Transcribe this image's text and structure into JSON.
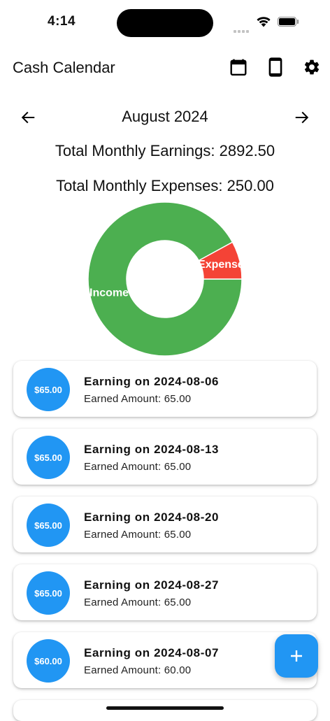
{
  "status_bar": {
    "time": "4:14"
  },
  "app_bar": {
    "title": "Cash Calendar",
    "actions": [
      {
        "icon": "calendar-icon"
      },
      {
        "icon": "phone-icon"
      },
      {
        "icon": "gear-icon"
      }
    ]
  },
  "month_nav": {
    "prev_icon": "arrow-left-icon",
    "next_icon": "arrow-right-icon",
    "month": "August 2024"
  },
  "summary": {
    "earnings": "Total Monthly Earnings: 2892.50",
    "expenses": "Total Monthly Expenses: 250.00"
  },
  "chart_data": {
    "type": "pie",
    "donut": true,
    "categories": [
      "Income",
      "Expense"
    ],
    "values": [
      2892.5,
      250.0
    ],
    "colors": [
      "#4CAF50",
      "#F44336"
    ],
    "labels": [
      "Income",
      "Expense"
    ]
  },
  "entries": [
    {
      "badge": "$65.00",
      "title": "Earning on 2024-08-06",
      "subtitle": "Earned Amount: 65.00"
    },
    {
      "badge": "$65.00",
      "title": "Earning on 2024-08-13",
      "subtitle": "Earned Amount: 65.00"
    },
    {
      "badge": "$65.00",
      "title": "Earning on 2024-08-20",
      "subtitle": "Earned Amount: 65.00"
    },
    {
      "badge": "$65.00",
      "title": "Earning on 2024-08-27",
      "subtitle": "Earned Amount: 65.00"
    },
    {
      "badge": "$60.00",
      "title": "Earning on 2024-08-07",
      "subtitle": "Earned Amount: 60.00"
    }
  ],
  "fab": {
    "icon": "plus-icon"
  },
  "colors": {
    "accent": "#2196F3",
    "income": "#4CAF50",
    "expense": "#F44336"
  }
}
